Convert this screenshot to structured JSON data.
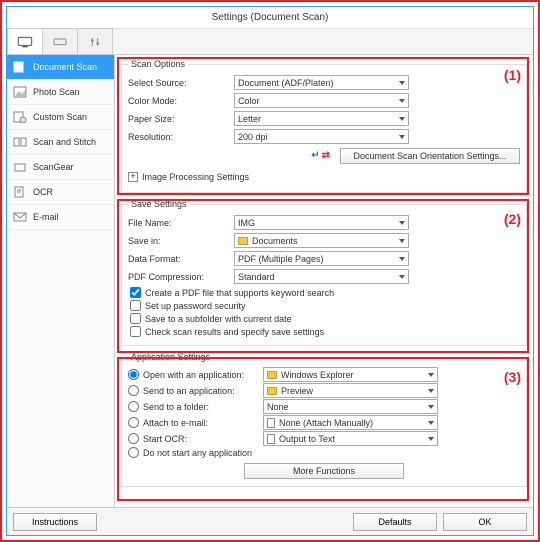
{
  "title": "Settings (Document Scan)",
  "sidebar": {
    "items": [
      {
        "label": "Document Scan"
      },
      {
        "label": "Photo Scan"
      },
      {
        "label": "Custom Scan"
      },
      {
        "label": "Scan and Stitch"
      },
      {
        "label": "ScanGear"
      },
      {
        "label": "OCR"
      },
      {
        "label": "E-mail"
      }
    ]
  },
  "scan": {
    "legend": "Scan Options",
    "source_lbl": "Select Source:",
    "source_val": "Document (ADF/Platen)",
    "color_lbl": "Color Mode:",
    "color_val": "Color",
    "paper_lbl": "Paper Size:",
    "paper_val": "Letter",
    "res_lbl": "Resolution:",
    "res_val": "200 dpi",
    "orient_btn": "Document Scan Orientation Settings...",
    "imgproc": "Image Processing Settings"
  },
  "save": {
    "legend": "Save Settings",
    "file_lbl": "File Name:",
    "file_val": "IMG",
    "savein_lbl": "Save in:",
    "savein_val": "Documents",
    "fmt_lbl": "Data Format:",
    "fmt_val": "PDF (Multiple Pages)",
    "comp_lbl": "PDF Compression:",
    "comp_val": "Standard",
    "chk1": "Create a PDF file that supports keyword search",
    "chk2": "Set up password security",
    "chk3": "Save to a subfolder with current date",
    "chk4": "Check scan results and specify save settings"
  },
  "app": {
    "legend": "Application Settings",
    "r1": "Open with an application:",
    "r1v": "Windows Explorer",
    "r2": "Send to an application:",
    "r2v": "Preview",
    "r3": "Send to a folder:",
    "r3v": "None",
    "r4": "Attach to e-mail:",
    "r4v": "None (Attach Manually)",
    "r5": "Start OCR:",
    "r5v": "Output to Text",
    "r6": "Do not start any application",
    "more": "More Functions"
  },
  "footer": {
    "instructions": "Instructions",
    "defaults": "Defaults",
    "ok": "OK"
  },
  "annot": {
    "n1": "(1)",
    "n2": "(2)",
    "n3": "(3)"
  }
}
